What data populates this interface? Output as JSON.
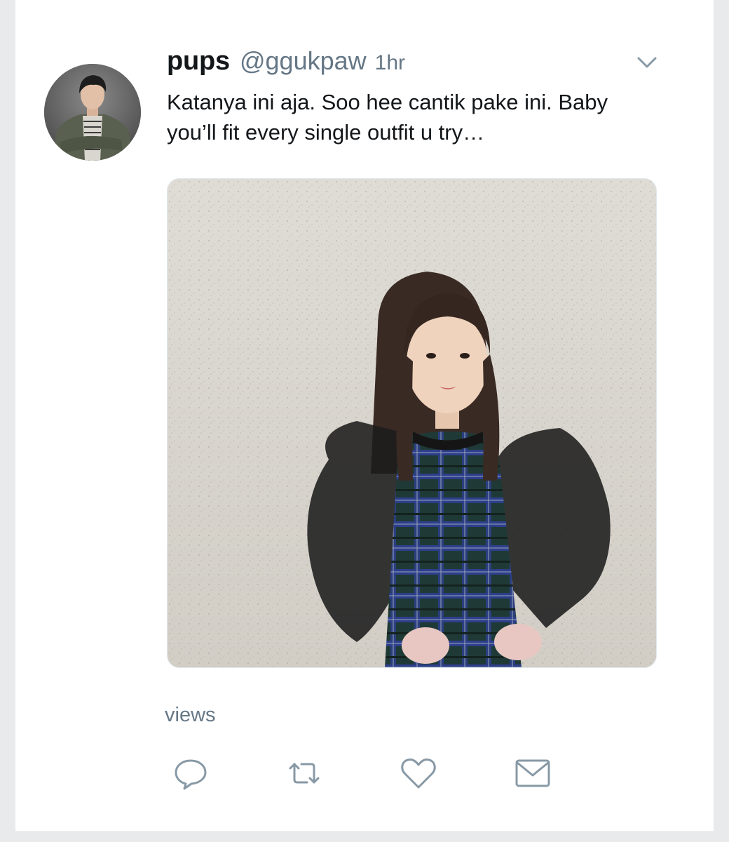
{
  "tweet": {
    "author": {
      "display_name": "pups",
      "handle": "@ggukpaw",
      "avatar": "profile-photo"
    },
    "timestamp": "1hr",
    "text_lines": [
      "Katanya ini aja. Soo hee cantik pake ini. Baby",
      "you’ll fit every single outfit u try…"
    ],
    "media": {
      "kind": "photo",
      "subject": "child-in-plaid-dress-with-sheer-black-sleeves"
    },
    "views_label": "views",
    "menu_icon": "chevron-down-icon",
    "actions": [
      {
        "name": "reply",
        "icon": "reply-icon"
      },
      {
        "name": "retweet",
        "icon": "retweet-icon"
      },
      {
        "name": "like",
        "icon": "heart-icon"
      },
      {
        "name": "share",
        "icon": "mail-icon"
      }
    ]
  },
  "colors": {
    "text_primary": "#14171a",
    "text_secondary": "#657786",
    "icon_gray": "#8899a6",
    "background": "#ffffff",
    "page_outer": "#e9eaec"
  }
}
